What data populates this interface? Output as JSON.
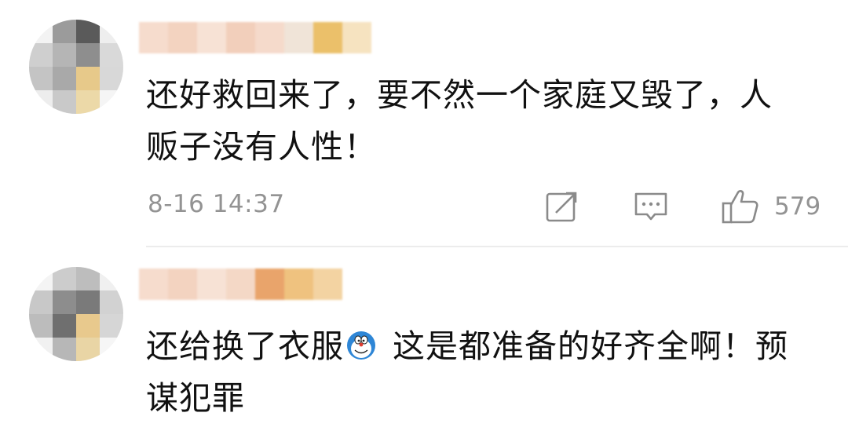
{
  "comments": [
    {
      "text": "还好救回来了，要不然一个家庭又毁了，人贩子没有人性！",
      "time": "8-16 14:37",
      "likes": "579",
      "icons": {
        "share": "share-icon",
        "reply": "comment-icon",
        "like": "thumbs-up-icon"
      }
    },
    {
      "text_before_emoji": "还给换了衣服",
      "emoji": "doraemon-emoji",
      "text_after_emoji": " 这是都准备的好齐全啊！预谋犯罪"
    }
  ],
  "colors": {
    "text": "#111111",
    "meta": "#939393",
    "divider": "#ececec"
  }
}
